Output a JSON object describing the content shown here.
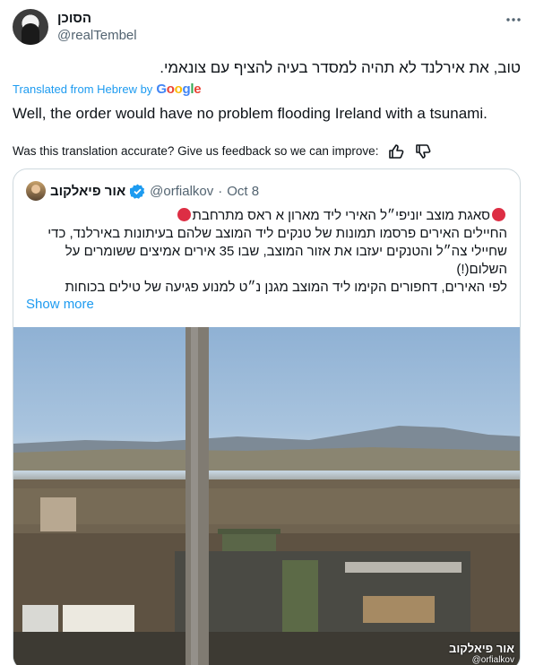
{
  "author": {
    "display_name": "הסוכן",
    "handle": "@realTembel"
  },
  "tweet": {
    "text_hebrew": "טוב, את אירלנד לא תהיה למסדר בעיה להציף עם צונאמי.",
    "translated_label": "Translated from Hebrew by",
    "translator_logo": "Google",
    "text_english": "Well, the order would have no problem flooding Ireland with a tsunami.",
    "feedback_prompt": "Was this translation accurate? Give us feedback so we can improve:"
  },
  "quoted": {
    "display_name": "אור פיאלקוב",
    "handle": "@orfialkov",
    "separator": "·",
    "date": "Oct 8",
    "lines": [
      "סאגת מוצב יוניפי״ל האירי ליד מארון א ראס מתרחבת",
      "החיילים האירים פרסמו תמונות של טנקים ליד המוצב שלהם בעיתונות באירלנד, כדי",
      "שחיילי צה״ל והטנקים יעזבו את אזור המוצב, שבו 35 אירים אמיצים ששומרים על",
      "השלום(!)",
      "לפי האירים, דחפורים הקימו ליד המוצב מגנן נ״ט למנוע פגיעה של טילים בכוחות"
    ],
    "show_more": "Show more",
    "watermark_name": "אור פיאלקוב",
    "watermark_handle": "@orfialkov"
  },
  "colors": {
    "accent": "#1d9bf0",
    "secondary_text": "#536471",
    "border": "#cfd9de",
    "alert": "#dd2e44"
  },
  "icons": [
    "more-icon",
    "thumbs-up-icon",
    "thumbs-down-icon",
    "verified-badge-icon",
    "red-circle-icon"
  ]
}
